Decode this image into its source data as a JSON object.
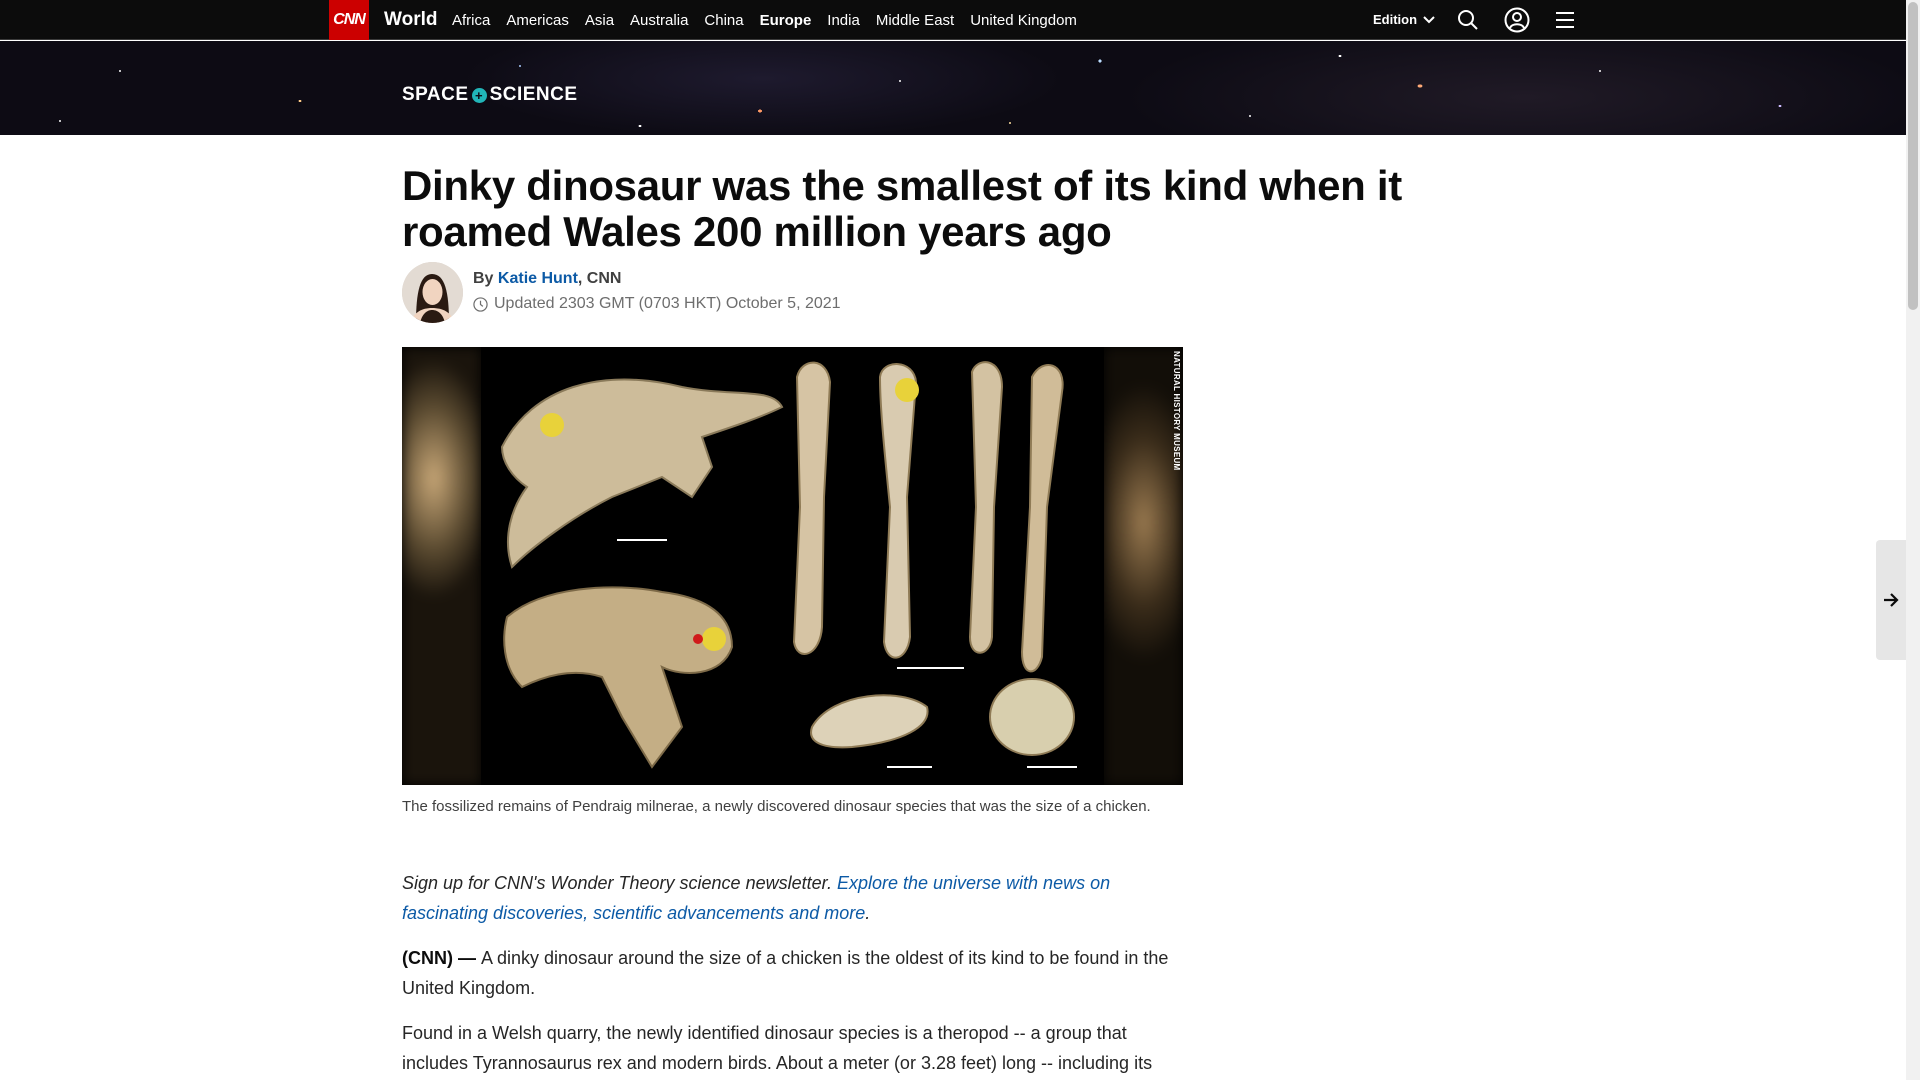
{
  "nav": {
    "logo": "CNN",
    "section": "World",
    "links": [
      "Africa",
      "Americas",
      "Asia",
      "Australia",
      "China",
      "Europe",
      "India",
      "Middle East",
      "United Kingdom"
    ],
    "active_link": "Europe",
    "edition_label": "Edition",
    "icons": [
      "search-icon",
      "account-icon",
      "menu-icon"
    ]
  },
  "banner": {
    "logo_left": "SPACE",
    "logo_plus": "+",
    "logo_right": "SCIENCE"
  },
  "article": {
    "headline": "Dinky dinosaur was the smallest of its kind when it roamed Wales 200 million years ago",
    "byline_prefix": "By",
    "author": "Katie Hunt",
    "outlet": ", CNN",
    "timestamp": "Updated 2303 GMT (0703 HKT) October 5, 2021",
    "photo_credit": "NATURAL HISTORY MUSEUM",
    "caption": "The fossilized remains of Pendraig milnerae, a newly discovered dinosaur species that was the size of a chicken.",
    "signup_text": "Sign up for CNN's Wonder Theory science newsletter. ",
    "signup_link": "Explore the universe with news on fascinating discoveries, scientific advancements and more",
    "signup_end": ".",
    "lead_dateline": "(CNN) — ",
    "lead_text": "A dinky dinosaur around the size of a chicken is the oldest of its kind to be found in the United Kingdom.",
    "para2": "Found in a Welsh quarry, the newly identified dinosaur species is a theropod -- a group that includes Tyrannosaurus rex and modern birds. About a meter (or 3.28 feet) long -- including its"
  },
  "colors": {
    "cnn_red": "#cc0000",
    "link_blue": "#0c5aa6",
    "nav_bg": "#0c0c0c",
    "science_accent": "#21b5b8"
  }
}
